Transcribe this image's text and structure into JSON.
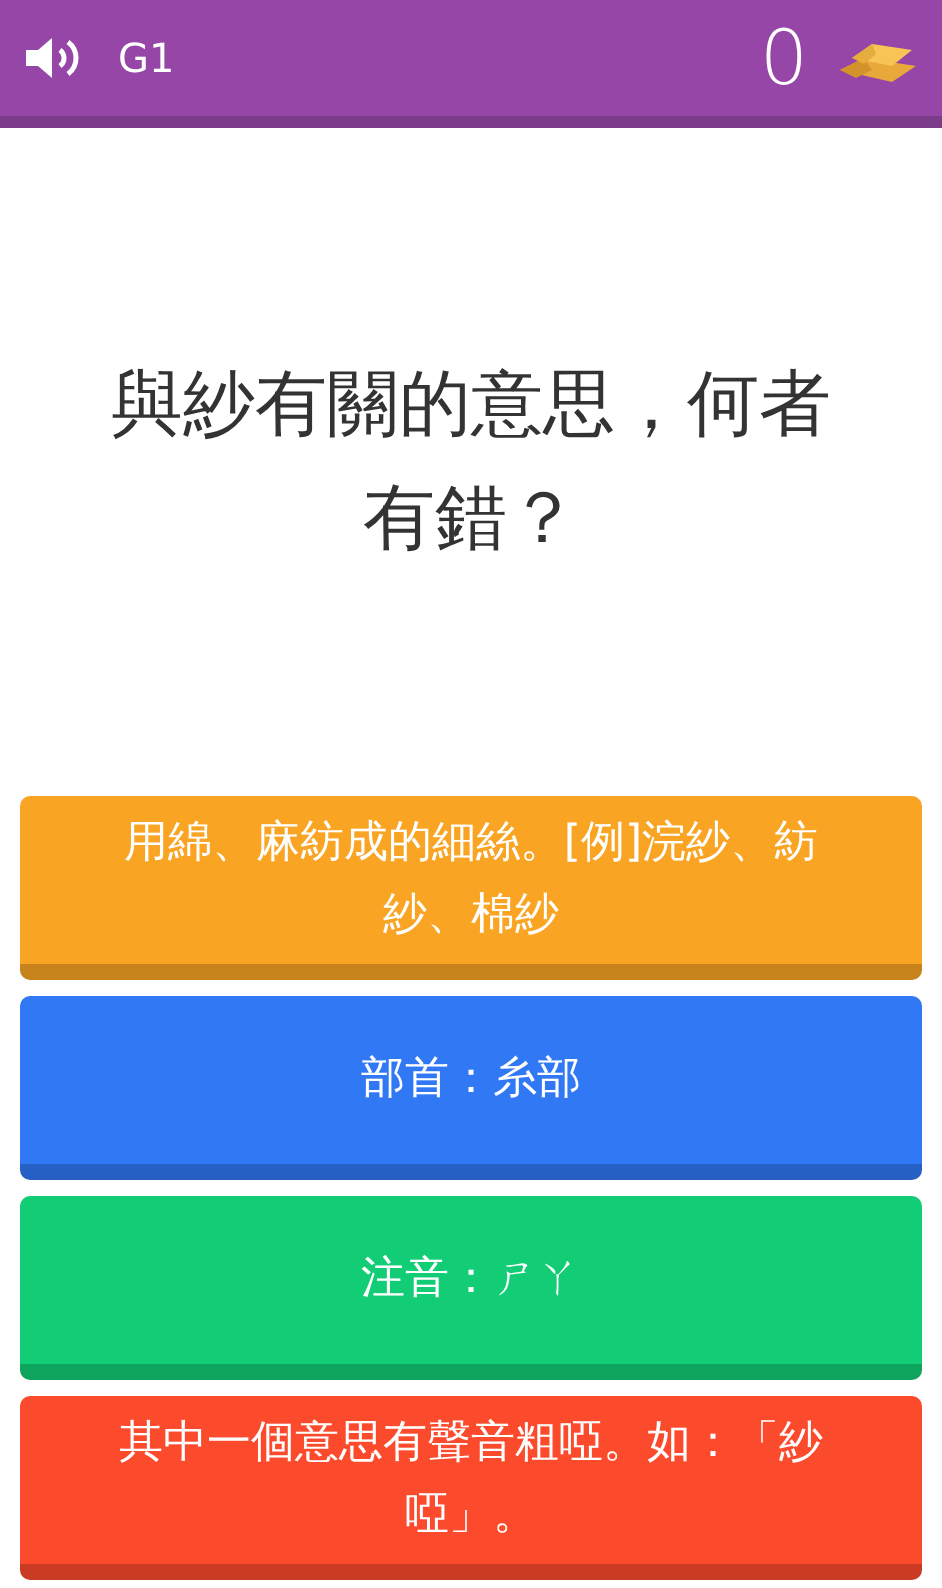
{
  "header": {
    "level_label": "G1",
    "score": "0"
  },
  "question": "與紗有關的意思，何者有錯？",
  "answers": [
    {
      "text": "用綿、麻紡成的細絲。[例]浣紗、紡紗、棉紗",
      "color": "#f9a423"
    },
    {
      "text": "部首：糸部",
      "color": "#3178f5"
    },
    {
      "text": "注音：ㄕㄚ",
      "color": "#13cd76"
    },
    {
      "text": "其中一個意思有聲音粗啞。如：「紗啞」。",
      "color": "#fc4a2c"
    }
  ]
}
